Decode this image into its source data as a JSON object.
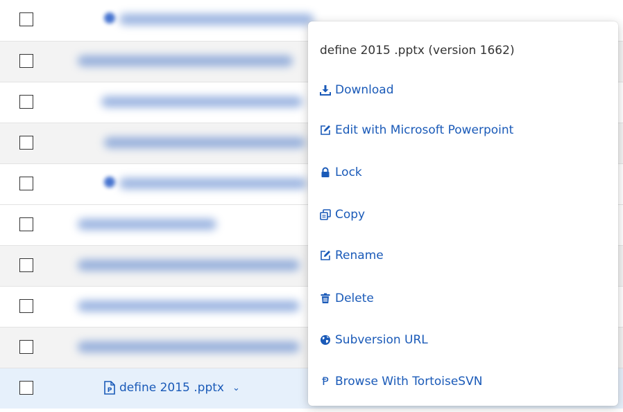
{
  "file_row": {
    "name": "define 2015 .pptx",
    "chevron": "⌄",
    "icon": "powerpoint-file-icon"
  },
  "context_menu": {
    "title": "define 2015 .pptx (version 1662)",
    "items": [
      {
        "label": "Download",
        "icon": "download-icon"
      },
      {
        "label": "Edit with Microsoft Powerpoint",
        "icon": "edit-icon"
      },
      {
        "label": "Lock",
        "icon": "lock-icon"
      },
      {
        "label": "Copy",
        "icon": "copy-icon"
      },
      {
        "label": "Rename",
        "icon": "edit-icon"
      },
      {
        "label": "Delete",
        "icon": "trash-icon"
      },
      {
        "label": "Subversion URL",
        "icon": "globe-icon"
      },
      {
        "label": "Browse With TortoiseSVN",
        "icon": "tortoisesvn-icon",
        "glyph": "Ᵽ"
      }
    ]
  },
  "colors": {
    "link": "#1a5ab8",
    "selected_row": "#e6f0fb",
    "shaded_row": "#f3f3f3"
  }
}
